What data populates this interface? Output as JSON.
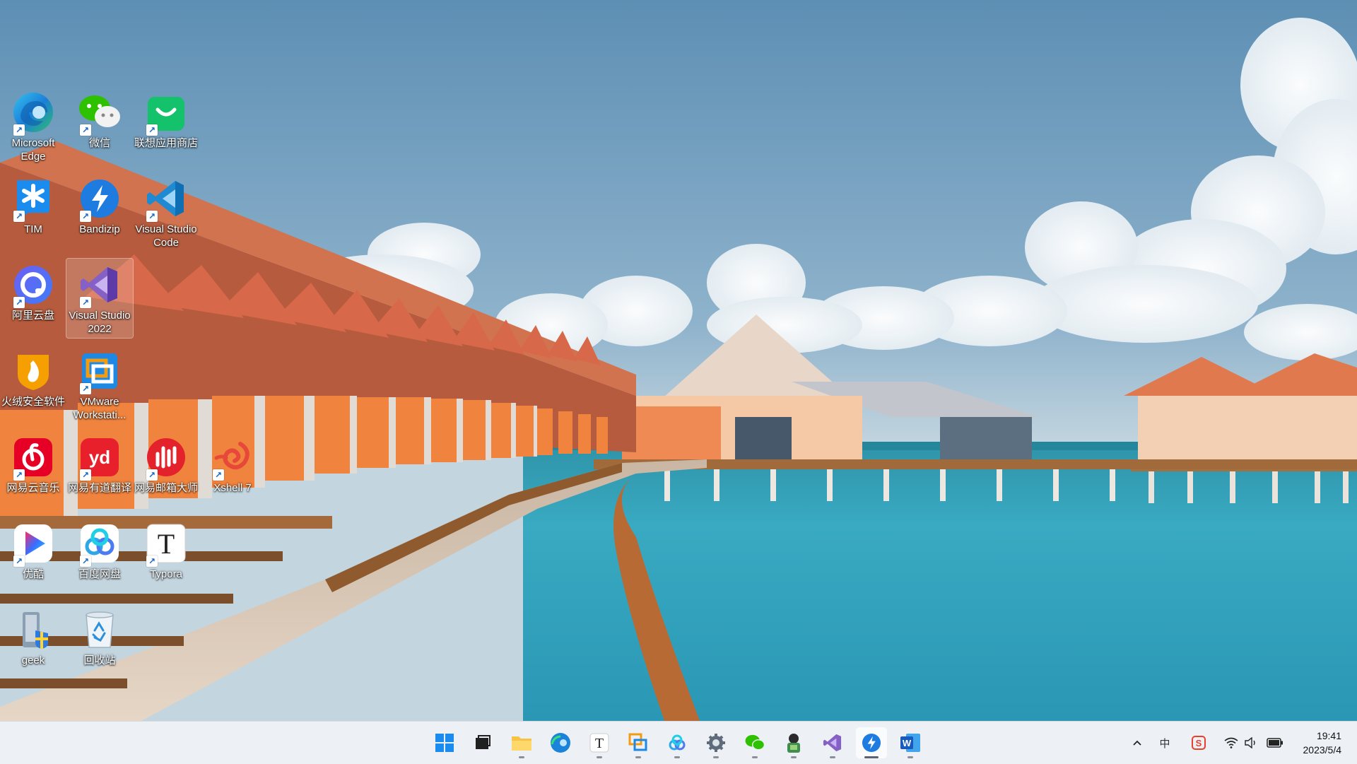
{
  "desktop": {
    "icons": [
      {
        "label": "Microsoft Edge",
        "icon": "edge-icon",
        "shortcut": true
      },
      {
        "label": "微信",
        "icon": "wechat-icon",
        "shortcut": true
      },
      {
        "label": "联想应用商店",
        "icon": "lenovo-store-icon",
        "shortcut": true
      },
      {
        "label": "TIM",
        "icon": "tim-icon",
        "shortcut": true
      },
      {
        "label": "Bandizip",
        "icon": "bandizip-icon",
        "shortcut": true
      },
      {
        "label": "Visual Studio Code",
        "icon": "vscode-icon",
        "shortcut": true
      },
      {
        "label": "阿里云盘",
        "icon": "aliyun-drive-icon",
        "shortcut": true
      },
      {
        "label": "Visual Studio 2022",
        "icon": "visual-studio-icon",
        "shortcut": true,
        "selected": true
      },
      {
        "label": "火绒安全软件",
        "icon": "huorong-icon",
        "shortcut": false
      },
      {
        "label": "VMware Workstati...",
        "icon": "vmware-icon",
        "shortcut": true
      },
      {
        "label": "网易云音乐",
        "icon": "netease-music-icon",
        "shortcut": true
      },
      {
        "label": "网易有道翻译",
        "icon": "youdao-icon",
        "shortcut": true
      },
      {
        "label": "网易邮箱大师",
        "icon": "netease-mail-icon",
        "shortcut": true
      },
      {
        "label": "Xshell 7",
        "icon": "xshell-icon",
        "shortcut": true
      },
      {
        "label": "优酷",
        "icon": "youku-icon",
        "shortcut": true
      },
      {
        "label": "百度网盘",
        "icon": "baidu-netdisk-icon",
        "shortcut": true
      },
      {
        "label": "Typora",
        "icon": "typora-icon",
        "shortcut": true
      },
      {
        "label": "geek",
        "icon": "geek-icon",
        "shortcut": false
      },
      {
        "label": "回收站",
        "icon": "recycle-bin-icon",
        "shortcut": false
      }
    ]
  },
  "taskbar": {
    "apps": [
      {
        "name": "start-button",
        "icon": "windows-start-icon",
        "running": false
      },
      {
        "name": "taskbar-task-view",
        "icon": "task-view-icon",
        "running": false
      },
      {
        "name": "taskbar-file-explorer",
        "icon": "folder-icon",
        "running": true
      },
      {
        "name": "taskbar-edge",
        "icon": "edge-icon",
        "running": false
      },
      {
        "name": "taskbar-typora",
        "icon": "typora-icon",
        "running": true
      },
      {
        "name": "taskbar-vmware",
        "icon": "vmware-icon",
        "running": true
      },
      {
        "name": "taskbar-baidu-netdisk",
        "icon": "baidu-netdisk-icon",
        "running": true
      },
      {
        "name": "taskbar-settings",
        "icon": "gear-icon",
        "running": true
      },
      {
        "name": "taskbar-wechat",
        "icon": "wechat-icon",
        "running": true
      },
      {
        "name": "taskbar-geek",
        "icon": "geek-icon",
        "running": true
      },
      {
        "name": "taskbar-visual-studio",
        "icon": "visual-studio-icon",
        "running": true
      },
      {
        "name": "taskbar-bandizip",
        "icon": "bandizip-icon",
        "running": true,
        "active": true
      },
      {
        "name": "taskbar-word",
        "icon": "word-icon",
        "running": true
      }
    ],
    "tray": {
      "overflow_glyph": "^",
      "ime_label": "中",
      "icons": [
        "chevron-up-icon",
        "ime-icon",
        "sogou-icon",
        "wifi-icon",
        "speaker-icon",
        "battery-icon"
      ]
    },
    "clock": {
      "time": "19:41",
      "date": "2023/5/4"
    }
  }
}
